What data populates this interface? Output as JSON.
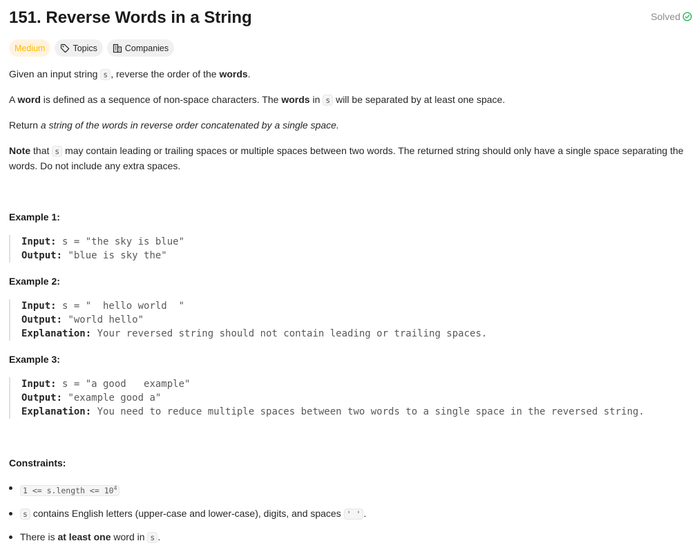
{
  "problem": {
    "title": "151. Reverse Words in a String",
    "solved_label": "Solved"
  },
  "tags": {
    "difficulty": "Medium",
    "topics": "Topics",
    "companies": "Companies"
  },
  "description": {
    "p1": {
      "a": "Given an input string ",
      "code": "s",
      "b": ", reverse the order of the ",
      "bold": "words",
      "c": "."
    },
    "p2": {
      "a": "A ",
      "bold1": "word",
      "b": " is defined as a sequence of non-space characters. The ",
      "bold2": "words",
      "c": " in ",
      "code": "s",
      "d": " will be separated by at least one space."
    },
    "p3": {
      "a": "Return ",
      "italic": "a string of the words in reverse order concatenated by a single space."
    },
    "p4": {
      "bold": "Note",
      "a": " that ",
      "code": "s",
      "b": " may contain leading or trailing spaces or multiple spaces between two words. The returned string should only have a single space separating the words. Do not include any extra spaces."
    }
  },
  "examples": [
    {
      "heading": "Example 1:",
      "input_label": "Input:",
      "input": " s = \"the sky is blue\"",
      "output_label": "Output:",
      "output": " \"blue is sky the\""
    },
    {
      "heading": "Example 2:",
      "input_label": "Input:",
      "input": " s = \"  hello world  \"",
      "output_label": "Output:",
      "output": " \"world hello\"",
      "explanation_label": "Explanation:",
      "explanation": " Your reversed string should not contain leading or trailing spaces."
    },
    {
      "heading": "Example 3:",
      "input_label": "Input:",
      "input": " s = \"a good   example\"",
      "output_label": "Output:",
      "output": " \"example good a\"",
      "explanation_label": "Explanation:",
      "explanation": " You need to reduce multiple spaces between two words to a single space in the reversed string."
    }
  ],
  "constraints": {
    "heading": "Constraints:",
    "c1": {
      "code": "1 <= s.length <= 10",
      "sup": "4"
    },
    "c2": {
      "code": "s",
      "text": " contains English letters (upper-case and lower-case), digits, and spaces ",
      "code2": "' '",
      "end": "."
    },
    "c3": {
      "a": "There is ",
      "bold": "at least one",
      "b": " word in ",
      "code": "s",
      "c": "."
    }
  },
  "colors": {
    "medium": "#ffb800",
    "solved_check": "#2db55d"
  },
  "icons": {
    "solved": "check-circle-icon",
    "topics": "tag-icon",
    "companies": "building-icon"
  }
}
